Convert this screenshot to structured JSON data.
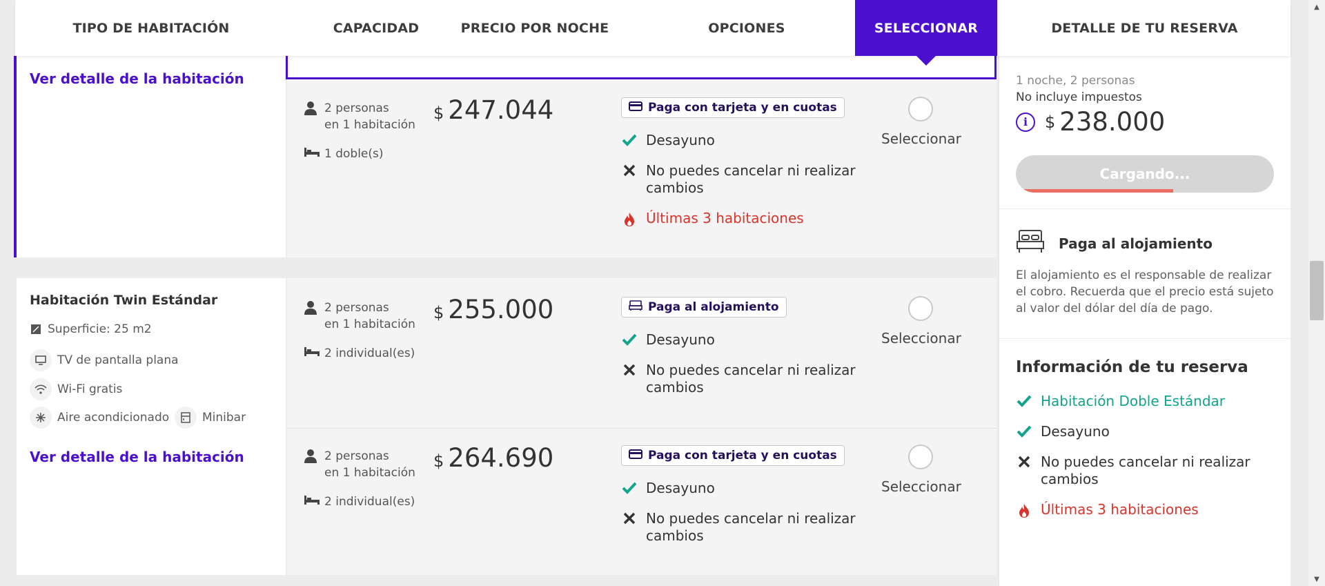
{
  "header": {
    "col_room_type": "TIPO DE HABITACIÓN",
    "col_capacity": "CAPACIDAD",
    "col_price": "PRECIO POR NOCHE",
    "col_options": "OPCIONES",
    "col_select": "SELECCIONAR",
    "col_detail": "DETALLE DE TU RESERVA"
  },
  "room1": {
    "detail_link": "Ver detalle de la habitación",
    "rate": {
      "people_line1": "2 personas",
      "people_line2": "en 1 habitación",
      "beds": "1 doble(s)",
      "currency": "$",
      "price": "247.044",
      "badge": "Paga con tarjeta y en cuotas",
      "opt_breakfast": "Desayuno",
      "opt_cancel_1": "No puedes cancelar ni realizar",
      "opt_cancel_2": "cambios",
      "opt_last": "Últimas 3 habitaciones",
      "select_label": "Seleccionar"
    }
  },
  "room2": {
    "title": "Habitación Twin Estándar",
    "surface": "Superficie: 25 m2",
    "amenity_tv": "TV de pantalla plana",
    "amenity_wifi": "Wi-Fi gratis",
    "amenity_ac": "Aire acondicionado",
    "amenity_minibar": "Minibar",
    "detail_link": "Ver detalle de la habitación",
    "rates": [
      {
        "people_line1": "2 personas",
        "people_line2": "en 1 habitación",
        "beds": "2 individual(es)",
        "currency": "$",
        "price": "255.000",
        "badge": "Paga al alojamiento",
        "opt_breakfast": "Desayuno",
        "opt_cancel_1": "No puedes cancelar ni realizar",
        "opt_cancel_2": "cambios",
        "select_label": "Seleccionar"
      },
      {
        "people_line1": "2 personas",
        "people_line2": "en 1 habitación",
        "beds": "2 individual(es)",
        "currency": "$",
        "price": "264.690",
        "badge": "Paga con tarjeta y en cuotas",
        "opt_breakfast": "Desayuno",
        "opt_cancel_1": "No puedes cancelar ni realizar",
        "opt_cancel_2": "cambios",
        "select_label": "Seleccionar"
      }
    ]
  },
  "sidebar": {
    "nights_people": "1 noche, 2 personas",
    "taxes": "No incluye impuestos",
    "currency": "$",
    "total": "238.000",
    "loading_label": "Cargando...",
    "loading_progress": 0.61,
    "pay_title": "Paga al alojamiento",
    "pay_desc_1": "El alojamiento es el responsable de realizar",
    "pay_desc_2": "el cobro. Recuerda que el precio está sujeto",
    "pay_desc_3": "al valor del dólar del día de pago.",
    "info_title": "Información de tu reserva",
    "info_room": "Habitación Doble Estándar",
    "info_breakfast": "Desayuno",
    "info_cancel_1": "No puedes cancelar ni realizar",
    "info_cancel_2": "cambios",
    "info_last": "Últimas 3 habitaciones"
  },
  "colors": {
    "accent": "#4a0fcf",
    "success": "#14a38b",
    "danger": "#d9342b",
    "progress": "#ee6e62"
  }
}
